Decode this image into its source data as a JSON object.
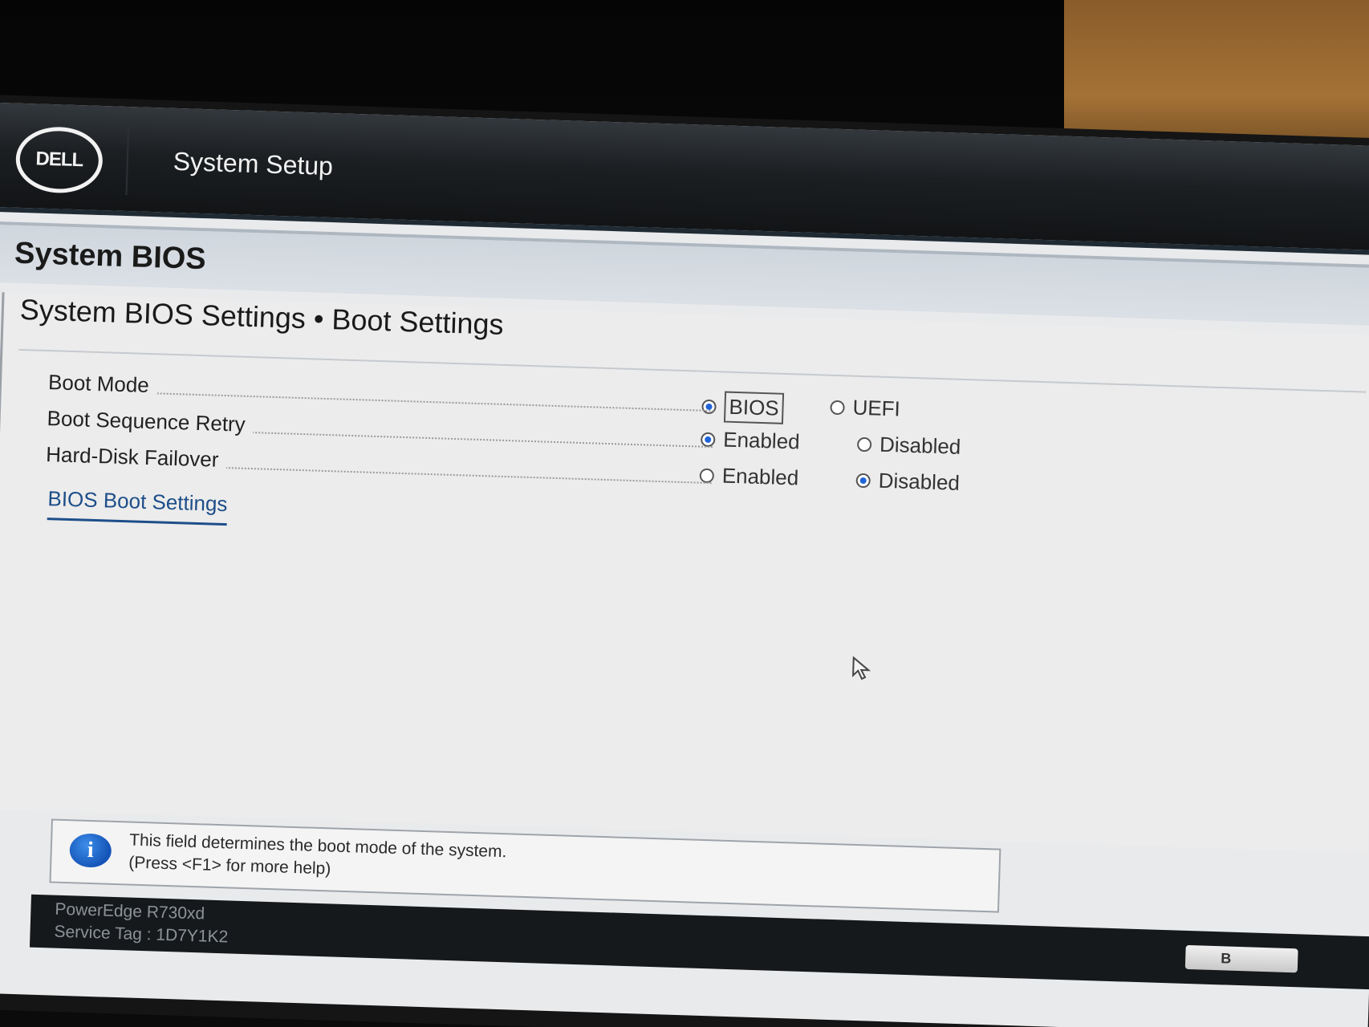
{
  "header": {
    "logo": "DELL",
    "title": "System Setup"
  },
  "section": {
    "title": "System BIOS"
  },
  "page": {
    "title": "System BIOS Settings • Boot Settings"
  },
  "settings": [
    {
      "label": "Boot Mode",
      "options": [
        {
          "label": "BIOS",
          "selected": true,
          "focused": true
        },
        {
          "label": "UEFI",
          "selected": false
        }
      ]
    },
    {
      "label": "Boot Sequence Retry",
      "options": [
        {
          "label": "Enabled",
          "selected": true
        },
        {
          "label": "Disabled",
          "selected": false
        }
      ]
    },
    {
      "label": "Hard-Disk Failover",
      "options": [
        {
          "label": "Enabled",
          "selected": false
        },
        {
          "label": "Disabled",
          "selected": true
        }
      ]
    }
  ],
  "link": {
    "label": "BIOS Boot Settings"
  },
  "help": {
    "line1": "This field determines the boot mode of the system.",
    "line2": "(Press <F1> for more help)"
  },
  "footer": {
    "model": "PowerEdge R730xd",
    "service_tag": "Service Tag : 1D7Y1K2",
    "back_button": "B"
  },
  "colors": {
    "radio_selected": "#1f63d8",
    "link": "#1d4e89",
    "header_bg": "#1c1f22"
  }
}
